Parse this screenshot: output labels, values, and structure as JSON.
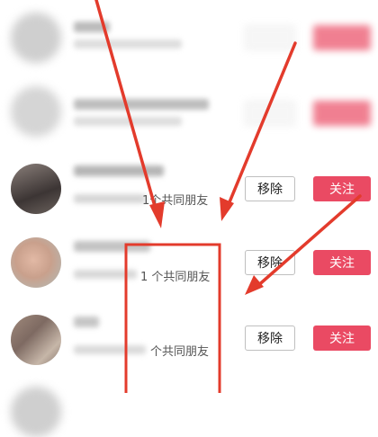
{
  "rows": [
    {
      "mutual": "",
      "remove_label": "",
      "follow_label": ""
    },
    {
      "mutual": "",
      "remove_label": "",
      "follow_label": ""
    },
    {
      "mutual": "1个共同朋友",
      "remove_label": "移除",
      "follow_label": "关注"
    },
    {
      "mutual": "1 个共同朋友",
      "remove_label": "移除",
      "follow_label": "关注"
    },
    {
      "mutual": "个共同朋友",
      "remove_label": "移除",
      "follow_label": "关注"
    }
  ],
  "colors": {
    "accent": "#ea4a63",
    "annotation": "#e33b2c"
  }
}
